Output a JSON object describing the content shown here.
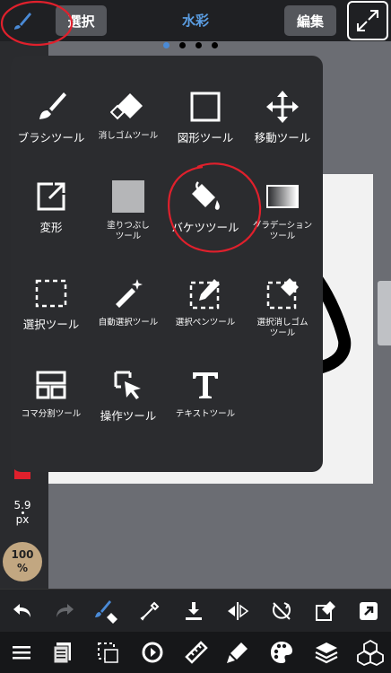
{
  "topbar": {
    "select_label": "選択",
    "title": "水彩",
    "edit_label": "編集"
  },
  "page_indicator": {
    "count": 4,
    "active": 0
  },
  "left_panel": {
    "brush_size_value": "5.9",
    "brush_size_unit": "px",
    "opacity_value": "100",
    "opacity_unit": "%"
  },
  "tool_menu": {
    "tools": [
      {
        "label": "ブラシツール",
        "icon": "brush-icon"
      },
      {
        "label": "消しゴムツール",
        "icon": "eraser-icon"
      },
      {
        "label": "図形ツール",
        "icon": "square-outline-icon"
      },
      {
        "label": "移動ツール",
        "icon": "move-arrows-icon"
      },
      {
        "label": "変形",
        "icon": "transform-icon"
      },
      {
        "label": "塗りつぶし\nツール",
        "icon": "fill-square-icon"
      },
      {
        "label": "バケツツール",
        "icon": "paint-bucket-icon"
      },
      {
        "label": "グラデーション\nツール",
        "icon": "gradient-icon"
      },
      {
        "label": "選択ツール",
        "icon": "selection-rect-icon"
      },
      {
        "label": "自動選択ツール",
        "icon": "magic-wand-icon"
      },
      {
        "label": "選択ペンツール",
        "icon": "selection-pen-icon"
      },
      {
        "label": "選択消しゴム\nツール",
        "icon": "selection-eraser-icon"
      },
      {
        "label": "コマ分割ツール",
        "icon": "panel-divide-icon"
      },
      {
        "label": "操作ツール",
        "icon": "operation-cursor-icon"
      },
      {
        "label": "テキストツール",
        "icon": "text-icon"
      }
    ]
  },
  "toolbar_icons": {
    "row1": [
      "undo-icon",
      "redo-icon",
      "brush-eraser-icon",
      "eyedropper-icon",
      "save-download-icon",
      "flip-icon",
      "rotate-reset-icon",
      "clear-layer-icon",
      "share-icon"
    ],
    "row2": [
      "menu-icon",
      "layers-list-icon",
      "selection-dashed-icon",
      "transform-rotate-icon",
      "ruler-icon",
      "pen-fill-icon",
      "palette-icon",
      "layer-stack-icon",
      "material-cube-icon"
    ]
  },
  "colors": {
    "accent": "#4a8ad6",
    "annotation": "#e0202c",
    "menu_bg": "#2b2c2f"
  }
}
